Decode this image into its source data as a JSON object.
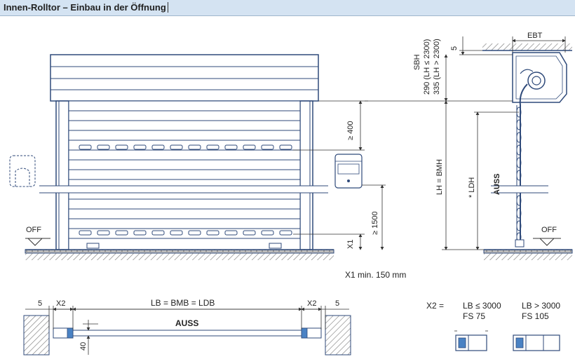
{
  "title": "Innen-Rolltor – Einbau in der Öffnung",
  "labels": {
    "ebt": "EBT",
    "five_top": "5",
    "sbh": "SBH",
    "sbh_290": "290 (LH ≤ 2300)",
    "sbh_335": "335 (LH > 2300)",
    "lh_bmh": "LH = BMH",
    "ldh": "* LDH",
    "auss_side": "AUSS",
    "ge400": "≥ 400",
    "ge1500": "≥ 1500",
    "x1": "X1",
    "off_left": "OFF",
    "off_right": "OFF",
    "x1_note": "X1 min. 150 mm",
    "five_left": "5",
    "x2_left": "X2",
    "lb": "LB = BMB = LDB",
    "x2_right": "X2",
    "five_right": "5",
    "auss_plan": "AUSS",
    "forty": "40",
    "x2_eq": "X2 =",
    "lb_le": "LB ≤ 3000",
    "fs75": "FS 75",
    "lb_gt": "LB > 3000",
    "fs105": "FS 105"
  },
  "colors": {
    "line": "#2f4a7a",
    "accent": "#1f5fa8",
    "title_bg": "#d4e3f2"
  }
}
